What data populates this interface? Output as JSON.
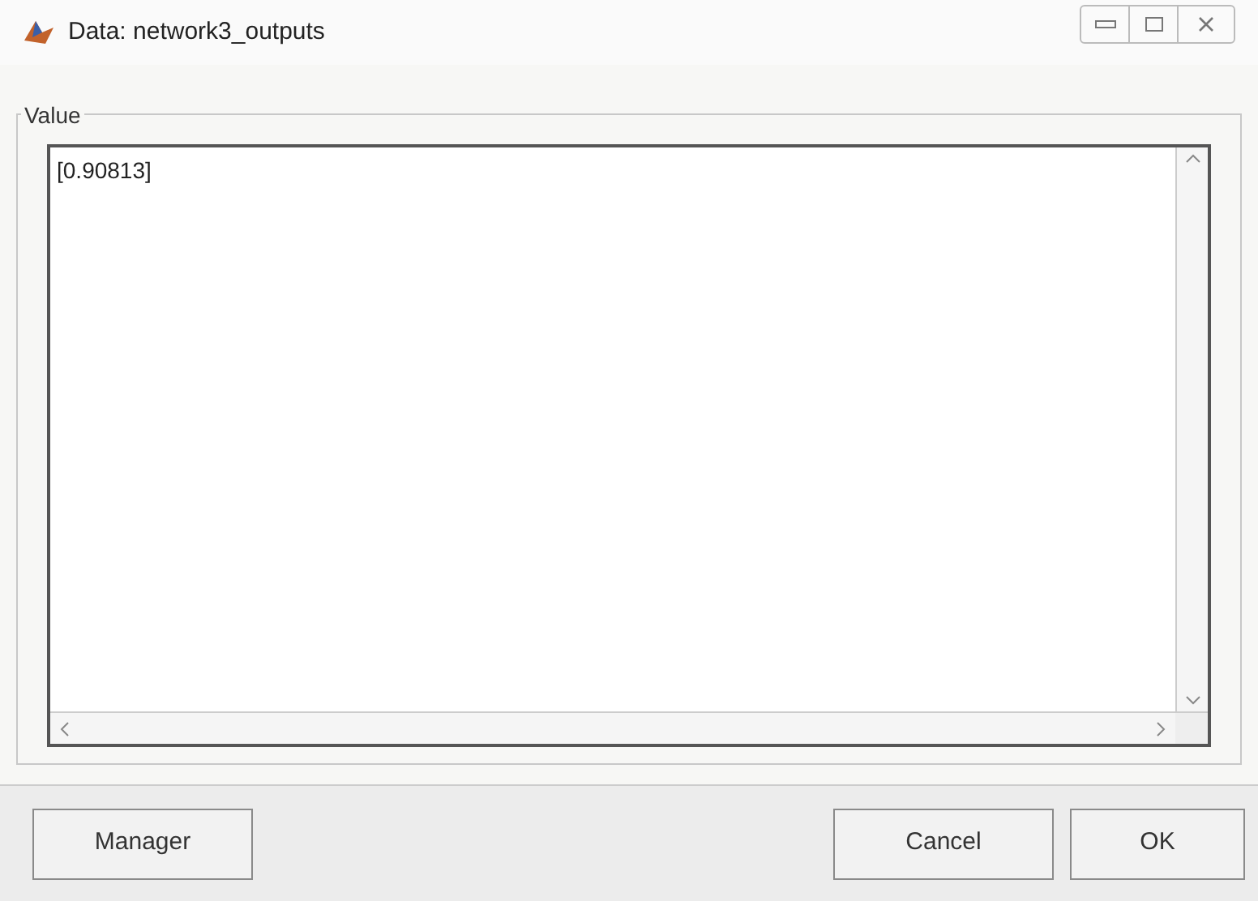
{
  "window": {
    "title": "Data: network3_outputs"
  },
  "group": {
    "label": "Value"
  },
  "value_field": {
    "value": "[0.90813]"
  },
  "buttons": [
    {
      "label": "Manager"
    },
    {
      "label": "Cancel"
    },
    {
      "label": "OK"
    }
  ]
}
